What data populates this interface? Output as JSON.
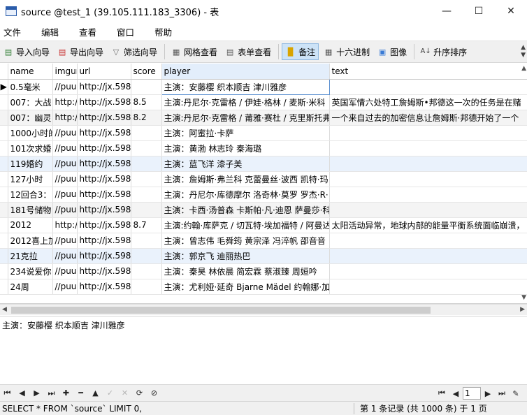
{
  "window": {
    "title": "source @test_1 (39.105.111.183_3306) - 表",
    "minimize": "—",
    "maximize": "☐",
    "close": "✕"
  },
  "menu": [
    "文件",
    "编辑",
    "查看",
    "窗口",
    "帮助"
  ],
  "toolbar": {
    "import_wizard": "导入向导",
    "export_wizard": "导出向导",
    "filter_wizard": "筛选向导",
    "grid_view": "网格查看",
    "form_view": "表单查看",
    "memo": "备注",
    "hex": "十六进制",
    "image": "图像",
    "sort_asc": "升序排序"
  },
  "columns": [
    "name",
    "imgurl",
    "url",
    "score",
    "player",
    "text"
  ],
  "rows": [
    [
      "0.5毫米",
      "//puu",
      "http://jx.598",
      "",
      "主演：安藤樱 织本顺吉 津川雅彦",
      ""
    ],
    [
      "007：大战",
      "http:/",
      "http://jx.598",
      "8.5",
      "主演:丹尼尔·克雷格 / 伊娃·格林 / 麦斯·米科",
      "英国军情六处特工詹姆斯•邦德这一次的任务是在赌"
    ],
    [
      "007：幽灵",
      "http:/",
      "http://jx.598",
      "8.2",
      "主演:丹尼尔·克雷格 / 莆雅·赛杜 / 克里斯托弗",
      "一个来自过去的加密信息让詹姆斯·邦德开始了一个"
    ],
    [
      "1000小时的",
      "//puu",
      "http://jx.598",
      "",
      "主演：阿蜜拉·卡萨",
      ""
    ],
    [
      "101次求婚",
      "//puu",
      "http://jx.598",
      "",
      "主演：黄渤 林志玲 秦海璐",
      ""
    ],
    [
      "119婚约",
      "//puu",
      "http://jx.598",
      "",
      "主演：蓝飞洋 漆子美",
      ""
    ],
    [
      "127小时",
      "//puu",
      "http://jx.598",
      "",
      "主演：詹姆斯·弗兰科 克蕾曼丝·波西 凯特·玛",
      ""
    ],
    [
      "12回合3：",
      "//puu",
      "http://jx.598",
      "",
      "主演：丹尼尔·库德摩尔 洛奇林·莫罗 罗杰·R·",
      ""
    ],
    [
      "181号储物",
      "//puu",
      "http://jx.598",
      "",
      "主演：卡西·汤普森 卡斯帕·凡·迪恩 萨曼莎·科",
      ""
    ],
    [
      "2012",
      "http:/",
      "http://jx.598",
      "8.7",
      "主演:约翰·库萨克 / 切瓦特·埃加福特 / 阿曼达",
      "太阳活动异常，地球内部的能量平衡系统面临崩溃，"
    ],
    [
      "2012喜上加",
      "//puu",
      "http://jx.598",
      "",
      "主演：曾志伟 毛舜筠 黄宗泽 冯淬帆 邵音音",
      ""
    ],
    [
      "21克拉",
      "//puu",
      "http://jx.598",
      "",
      "主演：郭京飞 迪丽热巴",
      ""
    ],
    [
      "234说爱你",
      "//puu",
      "http://jx.598",
      "",
      "主演：秦昊 林依晨 简宏霖 蔡淑臻 周姮吟",
      ""
    ],
    [
      "24周",
      "//puu",
      "http://jx.598",
      "",
      "主演：尤利娅·延奇 Bjarne Mädel 约翰娜·加",
      ""
    ]
  ],
  "preview_text": "主演：安藤樱 织本顺吉 津川雅彦",
  "current_page": "1",
  "status": {
    "sql": "SELECT * FROM `source` LIMIT 0,",
    "records": "第 1 条记录 (共 1000 条) 于 1 页"
  }
}
